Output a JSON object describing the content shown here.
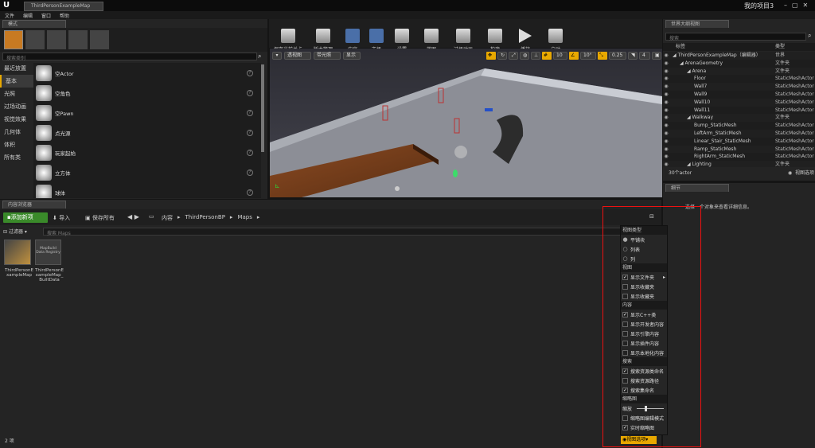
{
  "titlebar": {
    "logo": "U",
    "tab": "ThirdPersonExampleMap",
    "project": "我的项目3"
  },
  "menubar": [
    "文件",
    "编辑",
    "窗口",
    "帮助"
  ],
  "modes": {
    "tab": "模式",
    "search_placeholder": "搜索类别",
    "categories": [
      "最近放置",
      "基本",
      "光照",
      "过场动画",
      "视觉效果",
      "几何体",
      "体积",
      "所有类"
    ],
    "items": [
      "空Actor",
      "空角色",
      "空Pawn",
      "点光源",
      "玩家起始",
      "立方体",
      "球体"
    ]
  },
  "toolbar": [
    "保存当前关卡",
    "版本管理",
    "内容",
    "市场",
    "设置",
    "蓝图",
    "过场动画",
    "构建",
    "播放",
    "启动"
  ],
  "viewport": {
    "buttons": [
      "透视图",
      "带光照",
      "显示"
    ],
    "grid": "10",
    "angle": "10°",
    "scale": "0.25",
    "cam": "4"
  },
  "outliner": {
    "tab": "世界大纲视图",
    "search_placeholder": "搜索",
    "col_label": "标签",
    "col_type": "类型",
    "rows": [
      {
        "indent": 0,
        "name": "ThirdPersonExampleMap（编辑器）",
        "type": "世界"
      },
      {
        "indent": 1,
        "name": "ArenaGeometry",
        "type": "文件夹"
      },
      {
        "indent": 2,
        "name": "Arena",
        "type": "文件夹"
      },
      {
        "indent": 3,
        "name": "Floor",
        "type": "StaticMeshActor"
      },
      {
        "indent": 3,
        "name": "Wall7",
        "type": "StaticMeshActor"
      },
      {
        "indent": 3,
        "name": "Wall9",
        "type": "StaticMeshActor"
      },
      {
        "indent": 3,
        "name": "Wall10",
        "type": "StaticMeshActor"
      },
      {
        "indent": 3,
        "name": "Wall11",
        "type": "StaticMeshActor"
      },
      {
        "indent": 2,
        "name": "Walkway",
        "type": "文件夹"
      },
      {
        "indent": 3,
        "name": "Bump_StaticMesh",
        "type": "StaticMeshActor"
      },
      {
        "indent": 3,
        "name": "LeftArm_StaticMesh",
        "type": "StaticMeshActor"
      },
      {
        "indent": 3,
        "name": "Linear_Stair_StaticMesh",
        "type": "StaticMeshActor"
      },
      {
        "indent": 3,
        "name": "Ramp_StaticMesh",
        "type": "StaticMeshActor"
      },
      {
        "indent": 3,
        "name": "RightArm_StaticMesh",
        "type": "StaticMeshActor"
      },
      {
        "indent": 2,
        "name": "Lighting",
        "type": "文件夹"
      }
    ],
    "count": "30个actor",
    "view_options": "视图选项"
  },
  "details": {
    "tab": "细节",
    "empty": "选择一个对象来查看详细信息。"
  },
  "content": {
    "tab": "内容浏览器",
    "add_new": "添加新项",
    "import": "导入",
    "save_all": "保存所有",
    "path": [
      "内容",
      "ThirdPersonBP",
      "Maps"
    ],
    "filter": "过滤器",
    "search_placeholder": "搜索 Maps",
    "assets": [
      {
        "name": "ThirdPersonExampleMap",
        "thumb": ""
      },
      {
        "name": "ThirdPersonExampleMap_BuiltData",
        "thumb": "MapBuild Data Registry"
      }
    ],
    "count": "2 项"
  },
  "view_menu": {
    "sections": [
      {
        "header": "视图类型",
        "items": [
          {
            "kind": "radio",
            "on": true,
            "label": "平铺块"
          },
          {
            "kind": "radio",
            "on": false,
            "label": "列表"
          },
          {
            "kind": "radio",
            "on": false,
            "label": "列"
          }
        ]
      },
      {
        "header": "视图",
        "items": [
          {
            "kind": "check",
            "on": true,
            "label": "显示文件夹",
            "arrow": true
          },
          {
            "kind": "check",
            "on": false,
            "label": "显示收藏夹"
          },
          {
            "kind": "check",
            "on": false,
            "label": "显示收藏夹"
          }
        ]
      },
      {
        "header": "内容",
        "items": [
          {
            "kind": "check",
            "on": true,
            "label": "显示C++类"
          },
          {
            "kind": "check",
            "on": false,
            "label": "显示开发者内容"
          },
          {
            "kind": "check",
            "on": false,
            "label": "显示引擎内容"
          },
          {
            "kind": "check",
            "on": false,
            "label": "显示插件内容"
          },
          {
            "kind": "check",
            "on": false,
            "label": "显示本地化内容"
          }
        ]
      },
      {
        "header": "搜索",
        "items": [
          {
            "kind": "check",
            "on": true,
            "label": "搜索资源类命名"
          },
          {
            "kind": "check",
            "on": false,
            "label": "搜索资源路径"
          },
          {
            "kind": "check",
            "on": true,
            "label": "搜索集命名"
          }
        ]
      },
      {
        "header": "缩略图",
        "items": [
          {
            "kind": "slider",
            "label": "缩放",
            "value": 0.3
          },
          {
            "kind": "check",
            "on": false,
            "label": "缩略图编辑模式"
          },
          {
            "kind": "check",
            "on": true,
            "label": "实时缩略图"
          }
        ]
      }
    ],
    "button": "视图选项"
  }
}
